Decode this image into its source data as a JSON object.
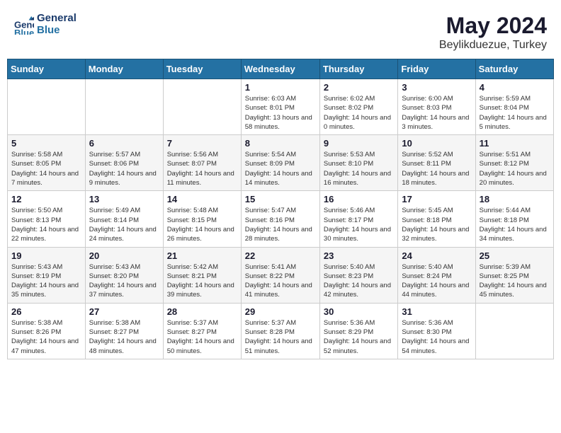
{
  "header": {
    "logo_line1": "General",
    "logo_line2": "Blue",
    "month_year": "May 2024",
    "location": "Beylikduezue, Turkey"
  },
  "days_of_week": [
    "Sunday",
    "Monday",
    "Tuesday",
    "Wednesday",
    "Thursday",
    "Friday",
    "Saturday"
  ],
  "weeks": [
    [
      {
        "num": "",
        "sunrise": "",
        "sunset": "",
        "daylight": ""
      },
      {
        "num": "",
        "sunrise": "",
        "sunset": "",
        "daylight": ""
      },
      {
        "num": "",
        "sunrise": "",
        "sunset": "",
        "daylight": ""
      },
      {
        "num": "1",
        "sunrise": "Sunrise: 6:03 AM",
        "sunset": "Sunset: 8:01 PM",
        "daylight": "Daylight: 13 hours and 58 minutes."
      },
      {
        "num": "2",
        "sunrise": "Sunrise: 6:02 AM",
        "sunset": "Sunset: 8:02 PM",
        "daylight": "Daylight: 14 hours and 0 minutes."
      },
      {
        "num": "3",
        "sunrise": "Sunrise: 6:00 AM",
        "sunset": "Sunset: 8:03 PM",
        "daylight": "Daylight: 14 hours and 3 minutes."
      },
      {
        "num": "4",
        "sunrise": "Sunrise: 5:59 AM",
        "sunset": "Sunset: 8:04 PM",
        "daylight": "Daylight: 14 hours and 5 minutes."
      }
    ],
    [
      {
        "num": "5",
        "sunrise": "Sunrise: 5:58 AM",
        "sunset": "Sunset: 8:05 PM",
        "daylight": "Daylight: 14 hours and 7 minutes."
      },
      {
        "num": "6",
        "sunrise": "Sunrise: 5:57 AM",
        "sunset": "Sunset: 8:06 PM",
        "daylight": "Daylight: 14 hours and 9 minutes."
      },
      {
        "num": "7",
        "sunrise": "Sunrise: 5:56 AM",
        "sunset": "Sunset: 8:07 PM",
        "daylight": "Daylight: 14 hours and 11 minutes."
      },
      {
        "num": "8",
        "sunrise": "Sunrise: 5:54 AM",
        "sunset": "Sunset: 8:09 PM",
        "daylight": "Daylight: 14 hours and 14 minutes."
      },
      {
        "num": "9",
        "sunrise": "Sunrise: 5:53 AM",
        "sunset": "Sunset: 8:10 PM",
        "daylight": "Daylight: 14 hours and 16 minutes."
      },
      {
        "num": "10",
        "sunrise": "Sunrise: 5:52 AM",
        "sunset": "Sunset: 8:11 PM",
        "daylight": "Daylight: 14 hours and 18 minutes."
      },
      {
        "num": "11",
        "sunrise": "Sunrise: 5:51 AM",
        "sunset": "Sunset: 8:12 PM",
        "daylight": "Daylight: 14 hours and 20 minutes."
      }
    ],
    [
      {
        "num": "12",
        "sunrise": "Sunrise: 5:50 AM",
        "sunset": "Sunset: 8:13 PM",
        "daylight": "Daylight: 14 hours and 22 minutes."
      },
      {
        "num": "13",
        "sunrise": "Sunrise: 5:49 AM",
        "sunset": "Sunset: 8:14 PM",
        "daylight": "Daylight: 14 hours and 24 minutes."
      },
      {
        "num": "14",
        "sunrise": "Sunrise: 5:48 AM",
        "sunset": "Sunset: 8:15 PM",
        "daylight": "Daylight: 14 hours and 26 minutes."
      },
      {
        "num": "15",
        "sunrise": "Sunrise: 5:47 AM",
        "sunset": "Sunset: 8:16 PM",
        "daylight": "Daylight: 14 hours and 28 minutes."
      },
      {
        "num": "16",
        "sunrise": "Sunrise: 5:46 AM",
        "sunset": "Sunset: 8:17 PM",
        "daylight": "Daylight: 14 hours and 30 minutes."
      },
      {
        "num": "17",
        "sunrise": "Sunrise: 5:45 AM",
        "sunset": "Sunset: 8:18 PM",
        "daylight": "Daylight: 14 hours and 32 minutes."
      },
      {
        "num": "18",
        "sunrise": "Sunrise: 5:44 AM",
        "sunset": "Sunset: 8:18 PM",
        "daylight": "Daylight: 14 hours and 34 minutes."
      }
    ],
    [
      {
        "num": "19",
        "sunrise": "Sunrise: 5:43 AM",
        "sunset": "Sunset: 8:19 PM",
        "daylight": "Daylight: 14 hours and 35 minutes."
      },
      {
        "num": "20",
        "sunrise": "Sunrise: 5:43 AM",
        "sunset": "Sunset: 8:20 PM",
        "daylight": "Daylight: 14 hours and 37 minutes."
      },
      {
        "num": "21",
        "sunrise": "Sunrise: 5:42 AM",
        "sunset": "Sunset: 8:21 PM",
        "daylight": "Daylight: 14 hours and 39 minutes."
      },
      {
        "num": "22",
        "sunrise": "Sunrise: 5:41 AM",
        "sunset": "Sunset: 8:22 PM",
        "daylight": "Daylight: 14 hours and 41 minutes."
      },
      {
        "num": "23",
        "sunrise": "Sunrise: 5:40 AM",
        "sunset": "Sunset: 8:23 PM",
        "daylight": "Daylight: 14 hours and 42 minutes."
      },
      {
        "num": "24",
        "sunrise": "Sunrise: 5:40 AM",
        "sunset": "Sunset: 8:24 PM",
        "daylight": "Daylight: 14 hours and 44 minutes."
      },
      {
        "num": "25",
        "sunrise": "Sunrise: 5:39 AM",
        "sunset": "Sunset: 8:25 PM",
        "daylight": "Daylight: 14 hours and 45 minutes."
      }
    ],
    [
      {
        "num": "26",
        "sunrise": "Sunrise: 5:38 AM",
        "sunset": "Sunset: 8:26 PM",
        "daylight": "Daylight: 14 hours and 47 minutes."
      },
      {
        "num": "27",
        "sunrise": "Sunrise: 5:38 AM",
        "sunset": "Sunset: 8:27 PM",
        "daylight": "Daylight: 14 hours and 48 minutes."
      },
      {
        "num": "28",
        "sunrise": "Sunrise: 5:37 AM",
        "sunset": "Sunset: 8:27 PM",
        "daylight": "Daylight: 14 hours and 50 minutes."
      },
      {
        "num": "29",
        "sunrise": "Sunrise: 5:37 AM",
        "sunset": "Sunset: 8:28 PM",
        "daylight": "Daylight: 14 hours and 51 minutes."
      },
      {
        "num": "30",
        "sunrise": "Sunrise: 5:36 AM",
        "sunset": "Sunset: 8:29 PM",
        "daylight": "Daylight: 14 hours and 52 minutes."
      },
      {
        "num": "31",
        "sunrise": "Sunrise: 5:36 AM",
        "sunset": "Sunset: 8:30 PM",
        "daylight": "Daylight: 14 hours and 54 minutes."
      },
      {
        "num": "",
        "sunrise": "",
        "sunset": "",
        "daylight": ""
      }
    ]
  ]
}
